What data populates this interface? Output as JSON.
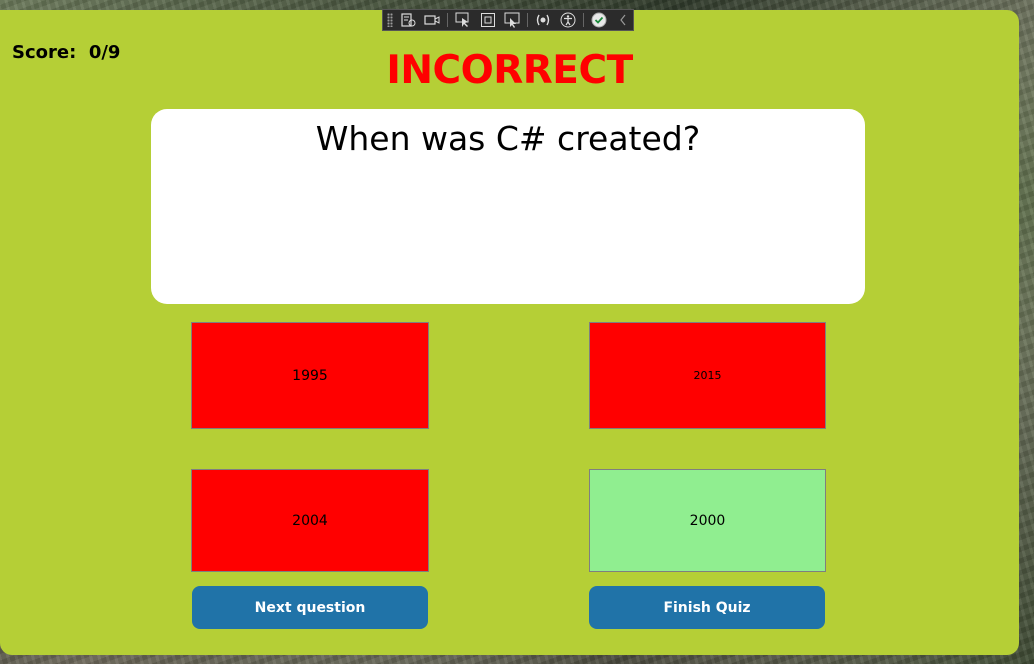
{
  "score": {
    "label": "Score:  0/9"
  },
  "result": {
    "title": "INCORRECT",
    "color": "#ff0000"
  },
  "question": {
    "text": "When was C# created?"
  },
  "answers": [
    {
      "label": "1995",
      "state": "wrong",
      "color": "#ff0000"
    },
    {
      "label": "2015",
      "state": "wrong",
      "color": "#ff0000"
    },
    {
      "label": "2004",
      "state": "wrong",
      "color": "#ff0000"
    },
    {
      "label": "2000",
      "state": "correct",
      "color": "#90ee90"
    }
  ],
  "buttons": {
    "next_label": "Next question",
    "finish_label": "Finish Quiz",
    "color": "#2073a8"
  },
  "theme": {
    "window_background": "#b5cf36",
    "card_background": "#ffffff"
  },
  "debug_toolbar": {
    "icons": [
      "live-visual-tree-icon",
      "record-icon",
      "select-element-icon",
      "display-layout-adorners-icon",
      "track-focus-icon",
      "binding-failures-icon",
      "accessibility-checker-icon",
      "hot-reload-ok-icon",
      "collapse-chevron-icon"
    ]
  }
}
